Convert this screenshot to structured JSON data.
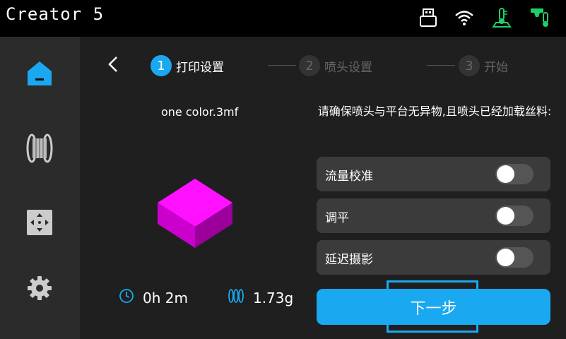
{
  "app": {
    "title": "Creator 5"
  },
  "status_icons": [
    "usb-icon",
    "wifi-icon",
    "bed-temperature-icon",
    "nozzle-temperature-icon"
  ],
  "sidebar": {
    "items": [
      {
        "icon": "home-icon",
        "active": true
      },
      {
        "icon": "filament-spool-icon",
        "active": false
      },
      {
        "icon": "move-control-icon",
        "active": false
      },
      {
        "icon": "settings-gear-icon",
        "active": false
      }
    ]
  },
  "steps": [
    {
      "number": "1",
      "label": "打印设置",
      "active": true
    },
    {
      "number": "2",
      "label": "喷头设置",
      "active": false
    },
    {
      "number": "3",
      "label": "开始",
      "active": false
    }
  ],
  "file": {
    "name": "one color.3mf",
    "time": "0h 2m",
    "weight": "1.73g"
  },
  "instruction": "请确保喷头与平台无异物,且喷头已经加载丝料:",
  "options": [
    {
      "label": "流量校准",
      "enabled": false
    },
    {
      "label": "调平",
      "enabled": false
    },
    {
      "label": "延迟摄影",
      "enabled": false
    }
  ],
  "next_button": "下一步",
  "colors": {
    "accent": "#1aa8f0",
    "model": "#e600e6"
  }
}
